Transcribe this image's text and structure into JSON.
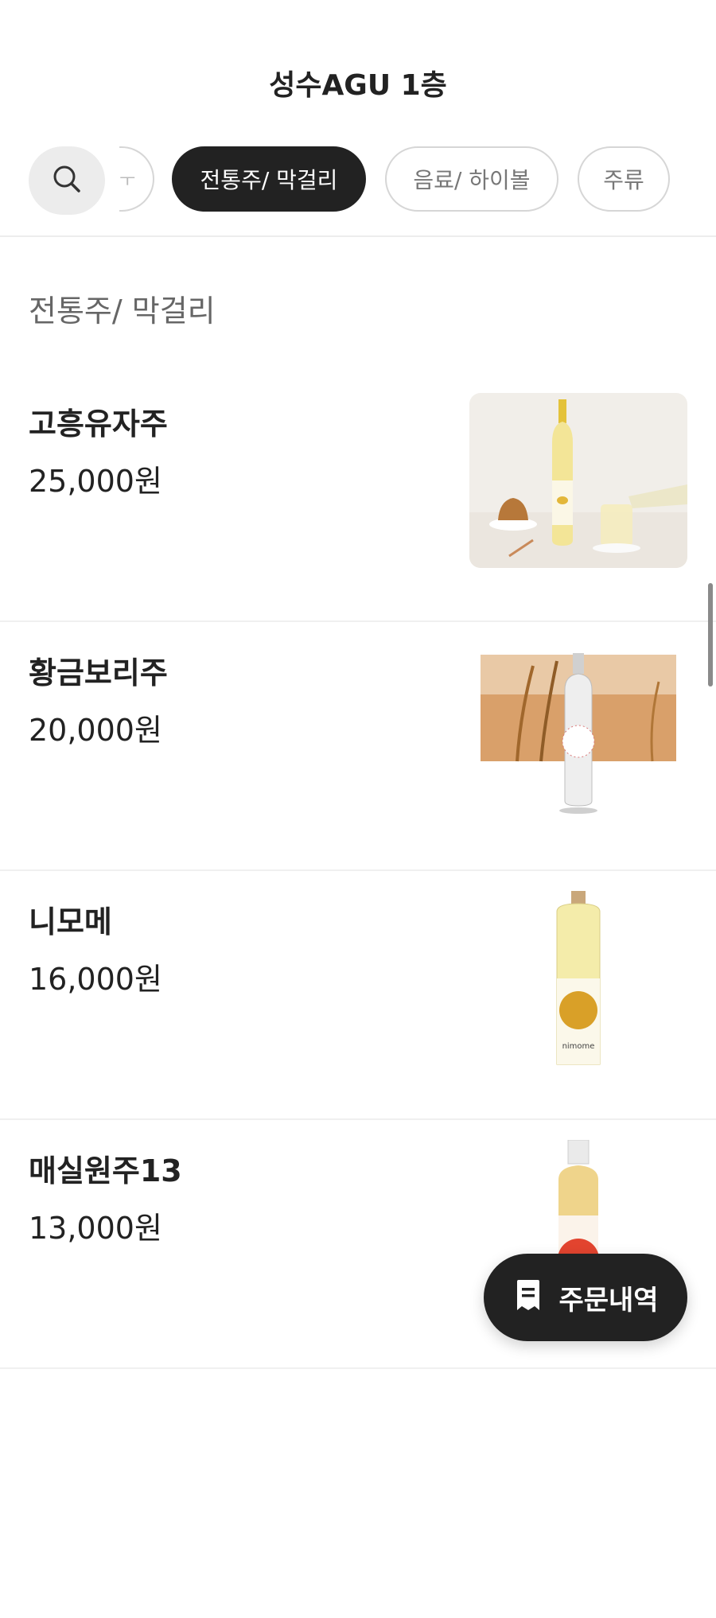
{
  "header": {
    "store_title": "성수AGU 1층"
  },
  "category_tabs": [
    {
      "label": "ㅜ",
      "state": "clipped"
    },
    {
      "label": "전통주/ 막걸리",
      "state": "selected"
    },
    {
      "label": "음료/ 하이볼",
      "state": "unselected"
    },
    {
      "label": "주류",
      "state": "unselected"
    }
  ],
  "section": {
    "title": "전통주/ 막걸리"
  },
  "menu_items": [
    {
      "name": "고흥유자주",
      "price": "25,000원",
      "image": "yuzu-liquor-bottle-image"
    },
    {
      "name": "황금보리주",
      "price": "20,000원",
      "image": "barley-liquor-bottle-image"
    },
    {
      "name": "니모메",
      "price": "16,000원",
      "image": "nimome-bottle-image"
    },
    {
      "name": "매실원주13",
      "price": "13,000원",
      "image": "plum-wine-bottle-image"
    },
    {
      "name": "",
      "price": "",
      "image": "partial-next-item-image"
    }
  ],
  "order_history_button": {
    "label": "주문내역",
    "icon": "receipt-icon"
  },
  "colors": {
    "accent": "#222222",
    "pill_border": "#d6d6d6",
    "search_bg": "#ececec"
  }
}
